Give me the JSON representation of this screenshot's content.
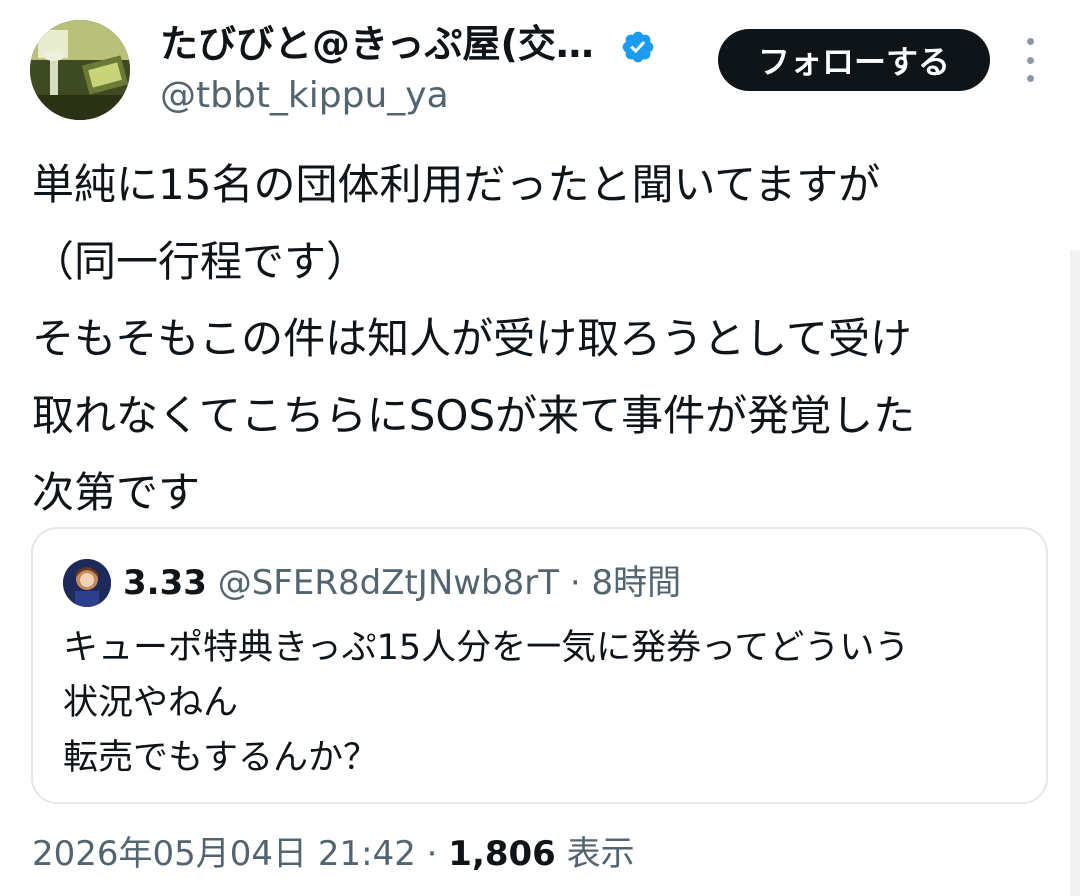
{
  "author": {
    "display_name": "たびびと@きっぷ屋(交…",
    "handle": "@tbbt_kippu_ya",
    "verified_icon": "verified-badge-icon",
    "avatar_icon": "avatar-image"
  },
  "header": {
    "follow_label": "フォローする",
    "more_icon": "more-options-icon"
  },
  "tweet": {
    "lines": [
      "単純に15名の団体利用だったと聞いてますが",
      "（同一行程です）",
      "そもそもこの件は知人が受け取ろうとして受け",
      "取れなくてこちらにSOSが来て事件が発覚した",
      "次第です"
    ]
  },
  "quote": {
    "display_name": "3.33",
    "handle": "@SFER8dZtJNwb8rT",
    "separator": "·",
    "time": "8時間",
    "lines": [
      "キューポ特典きっぷ15人分を一気に発券ってどういう",
      "状況やねん",
      "転売でもするんか？"
    ]
  },
  "meta": {
    "timestamp": "2026年05月04日 21:42",
    "separator": "·",
    "views_count": "1,806",
    "views_label": "表示"
  },
  "colors": {
    "verified": "#1d9bf0",
    "text_primary": "#0f1419",
    "text_secondary": "#536471",
    "border": "#e4e8ec",
    "button_bg": "#0f1419"
  }
}
